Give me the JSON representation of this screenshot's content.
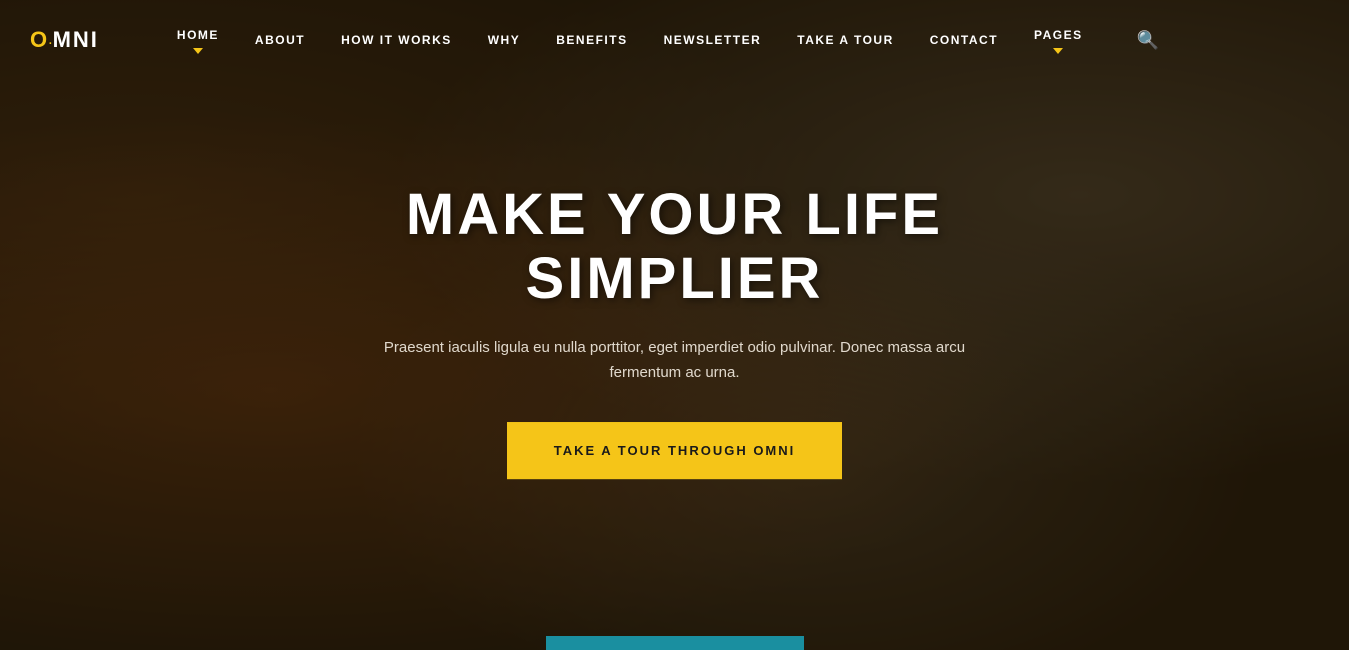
{
  "logo": {
    "o": "O",
    "dot": ".",
    "mni": "MNI"
  },
  "nav": {
    "items": [
      {
        "label": "HOME",
        "has_dropdown": true
      },
      {
        "label": "ABOUT",
        "has_dropdown": false
      },
      {
        "label": "HOW IT WORKS",
        "has_dropdown": false
      },
      {
        "label": "WHY",
        "has_dropdown": false
      },
      {
        "label": "BENEFITS",
        "has_dropdown": false
      },
      {
        "label": "NEWSLETTER",
        "has_dropdown": false
      },
      {
        "label": "TAKE A TOUR",
        "has_dropdown": false
      },
      {
        "label": "CONTACT",
        "has_dropdown": false
      },
      {
        "label": "PAGES",
        "has_dropdown": true
      }
    ]
  },
  "hero": {
    "title": "MAKE YOUR LIFE SIMPLIER",
    "subtitle": "Praesent iaculis ligula eu nulla porttitor, eget imperdiet odio pulvinar. Donec massa arcu fermentum ac urna.",
    "cta_label": "TAKE A TOUR THROUGH OMNI"
  },
  "colors": {
    "accent": "#f5c518",
    "bg_dark": "#2d1f0a",
    "text_white": "#ffffff"
  }
}
